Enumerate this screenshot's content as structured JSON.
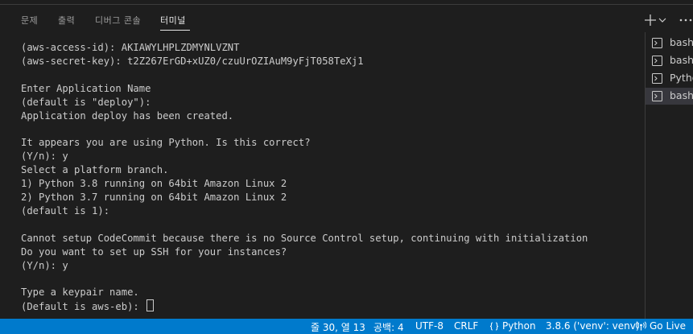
{
  "panel": {
    "tabs": [
      {
        "label": "문제"
      },
      {
        "label": "출력"
      },
      {
        "label": "디버그 콘솔"
      },
      {
        "label": "터미널"
      }
    ],
    "active_tab": "터미널"
  },
  "terminal": {
    "lines": [
      "(aws-access-id): AKIAWYLHPLZDMYNLVZNT",
      "(aws-secret-key): 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",
      "",
      "Enter Application Name",
      "(default is \"deploy\"):",
      "Application deploy has been created.",
      "",
      "It appears you are using Python. Is this correct?",
      "(Y/n): y",
      "Select a platform branch.",
      "1) Python 3.8 running on 64bit Amazon Linux 2",
      "2) Python 3.7 running on 64bit Amazon Linux 2",
      "(default is 1):",
      "",
      "Cannot setup CodeCommit because there is no Source Control setup, continuing with initialization",
      "Do you want to set up SSH for your instances?",
      "(Y/n): y",
      "",
      "Type a keypair name.",
      "(Default is aws-eb): "
    ]
  },
  "terminal_list": [
    {
      "label": "bash"
    },
    {
      "label": "bash"
    },
    {
      "label": "Pytho"
    },
    {
      "label": "bash",
      "selected": true
    }
  ],
  "statusbar": {
    "position": "줄 30, 열 13",
    "indent": "공백: 4",
    "encoding": "UTF-8",
    "eol": "CRLF",
    "language": "Python",
    "interpreter": "3.8.6 ('venv': venv)",
    "golive": "Go Live"
  },
  "icons": {
    "new_terminal": "plus-icon",
    "dropdown": "chevron-down-icon",
    "terminal": "terminal-icon",
    "language": "braces-icon",
    "golive": "broadcast-icon"
  },
  "colors": {
    "background": "#1e1e1e",
    "statusbar": "#007acc",
    "text": "#cccccc"
  }
}
